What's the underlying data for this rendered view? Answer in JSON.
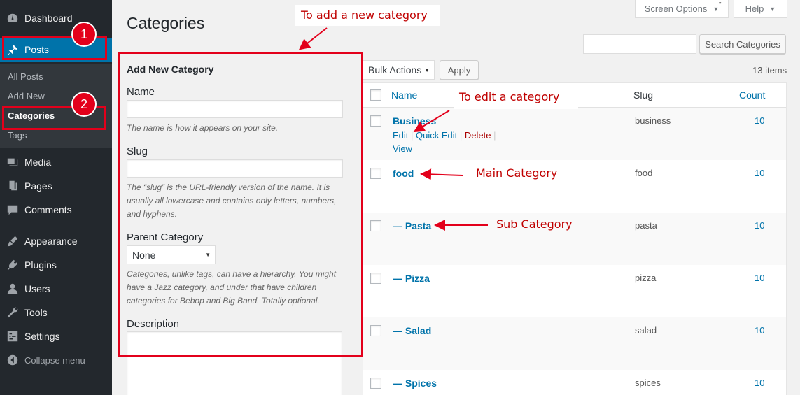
{
  "sidebar": {
    "dashboard": "Dashboard",
    "posts": "Posts",
    "posts_sub": [
      "All Posts",
      "Add New",
      "Categories",
      "Tags"
    ],
    "media": "Media",
    "pages": "Pages",
    "comments": "Comments",
    "appearance": "Appearance",
    "plugins": "Plugins",
    "users": "Users",
    "tools": "Tools",
    "settings": "Settings",
    "collapse": "Collapse menu"
  },
  "header": {
    "title": "Categories",
    "screen_options": "Screen Options",
    "help": "Help"
  },
  "form": {
    "title": "Add New Category",
    "name_label": "Name",
    "name_help": "The name is how it appears on your site.",
    "slug_label": "Slug",
    "slug_help": "The “slug” is the URL-friendly version of the name. It is usually all lowercase and contains only letters, numbers, and hyphens.",
    "parent_label": "Parent Category",
    "parent_value": "None",
    "parent_help": "Categories, unlike tags, can have a hierarchy. You might have a Jazz category, and under that have children categories for Bebop and Big Band. Totally optional.",
    "description_label": "Description"
  },
  "list": {
    "search_button": "Search Categories",
    "bulk_actions": "Bulk Actions",
    "apply": "Apply",
    "items_count": "13 items",
    "columns": {
      "name": "Name",
      "slug": "Slug",
      "count": "Count"
    },
    "row_actions": {
      "edit": "Edit",
      "quick_edit": "Quick Edit",
      "delete": "Delete",
      "view": "View"
    },
    "rows": [
      {
        "name": "Business",
        "slug": "business",
        "count": "10"
      },
      {
        "name": "food",
        "slug": "food",
        "count": "10"
      },
      {
        "name": "— Pasta",
        "slug": "pasta",
        "count": "10"
      },
      {
        "name": "— Pizza",
        "slug": "pizza",
        "count": "10"
      },
      {
        "name": "— Salad",
        "slug": "salad",
        "count": "10"
      },
      {
        "name": "— Spices",
        "slug": "spices",
        "count": "10"
      }
    ]
  },
  "annotations": {
    "add_new": "To add a new category",
    "edit": "To edit a category",
    "main": "Main Category",
    "sub": "Sub Category",
    "badge1": "1",
    "badge2": "2",
    "color": "#e3001b"
  }
}
